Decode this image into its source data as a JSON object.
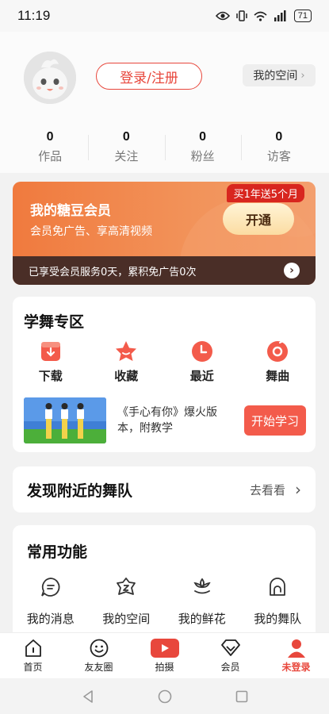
{
  "status_bar": {
    "time": "11:19",
    "battery": "71"
  },
  "profile": {
    "login_label": "登录/注册",
    "space_label": "我的空间",
    "stats": [
      {
        "value": "0",
        "label": "作品"
      },
      {
        "value": "0",
        "label": "关注"
      },
      {
        "value": "0",
        "label": "粉丝"
      },
      {
        "value": "0",
        "label": "访客"
      }
    ]
  },
  "member": {
    "title": "我的糖豆会员",
    "subtitle": "会员免广告、享高清视频",
    "promo": "买1年送5个月",
    "open_label": "开通",
    "bar_text": "已享受会员服务0天，累积免广告0次"
  },
  "dance": {
    "title": "学舞专区",
    "shortcuts": [
      {
        "label": "下载",
        "icon": "download-icon"
      },
      {
        "label": "收藏",
        "icon": "star-icon"
      },
      {
        "label": "最近",
        "icon": "clock-icon"
      },
      {
        "label": "舞曲",
        "icon": "music-disc-icon"
      }
    ],
    "course_title": "《手心有你》爆火版本，附教学",
    "learn_label": "开始学习"
  },
  "team": {
    "title": "发现附近的舞队",
    "link_label": "去看看"
  },
  "functions": {
    "title": "常用功能",
    "items": [
      {
        "label": "我的消息",
        "icon": "message-icon"
      },
      {
        "label": "我的空间",
        "icon": "space-icon"
      },
      {
        "label": "我的鲜花",
        "icon": "flower-icon"
      },
      {
        "label": "我的舞队",
        "icon": "team-icon"
      }
    ]
  },
  "tabbar": {
    "tabs": [
      {
        "label": "首页",
        "icon": "home-icon"
      },
      {
        "label": "友友圈",
        "icon": "smile-icon"
      },
      {
        "label": "拍摄",
        "icon": "camera-icon"
      },
      {
        "label": "会员",
        "icon": "diamond-icon"
      },
      {
        "label": "未登录",
        "icon": "user-icon"
      }
    ]
  },
  "colors": {
    "accent": "#e8473c",
    "member_gradient_start": "#f07a3e",
    "member_bar": "#4a2e27"
  }
}
